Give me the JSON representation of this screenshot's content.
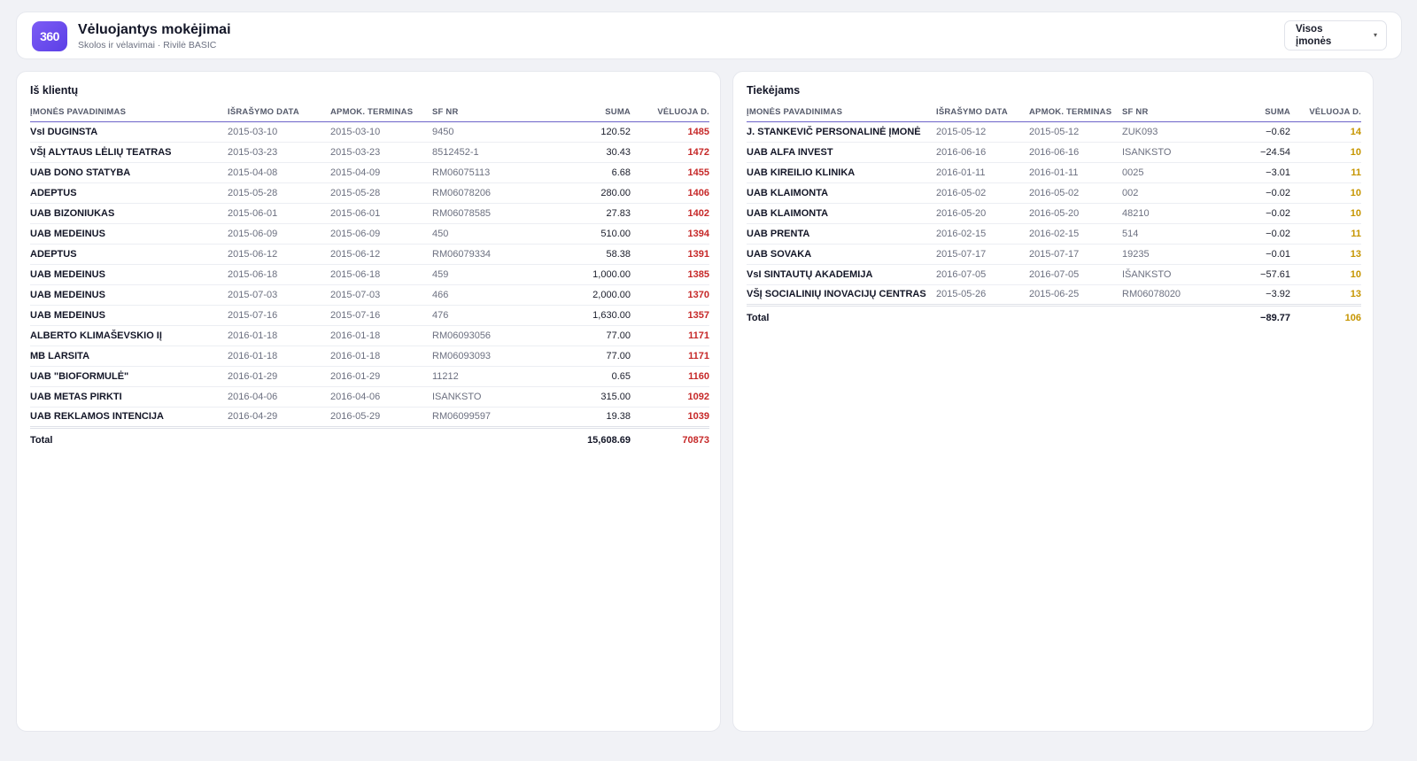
{
  "app": {
    "logo_text": "360",
    "title": "Vėluojantys mokėjimai",
    "subtitle": "Skolos ir vėlavimai · Rivilė BASIC",
    "company_filter": "Visos įmonės",
    "accent_color": "#6d4ef0"
  },
  "clients": {
    "title": "Iš klientų",
    "columns": [
      "ĮMONĖS PAVADINIMAS",
      "IŠRAŠYMO DATA",
      "APMOK. TERMINAS",
      "SF NR",
      "SUMA",
      "VĖLUOJA D."
    ],
    "rows": [
      {
        "name": "VsI DUGINSTA",
        "issued": "2015-03-10",
        "due": "2015-03-10",
        "sf": "9450",
        "sum": "120.52",
        "late": "1485"
      },
      {
        "name": "VŠĮ ALYTAUS LĖLIŲ TEATRAS",
        "issued": "2015-03-23",
        "due": "2015-03-23",
        "sf": "8512452-1",
        "sum": "30.43",
        "late": "1472"
      },
      {
        "name": "UAB DONO STATYBA",
        "issued": "2015-04-08",
        "due": "2015-04-09",
        "sf": "RM06075113",
        "sum": "6.68",
        "late": "1455"
      },
      {
        "name": "ADEPTUS",
        "issued": "2015-05-28",
        "due": "2015-05-28",
        "sf": "RM06078206",
        "sum": "280.00",
        "late": "1406"
      },
      {
        "name": "UAB BIZONIUKAS",
        "issued": "2015-06-01",
        "due": "2015-06-01",
        "sf": "RM06078585",
        "sum": "27.83",
        "late": "1402"
      },
      {
        "name": "UAB MEDEINUS",
        "issued": "2015-06-09",
        "due": "2015-06-09",
        "sf": "450",
        "sum": "510.00",
        "late": "1394"
      },
      {
        "name": "ADEPTUS",
        "issued": "2015-06-12",
        "due": "2015-06-12",
        "sf": "RM06079334",
        "sum": "58.38",
        "late": "1391"
      },
      {
        "name": "UAB MEDEINUS",
        "issued": "2015-06-18",
        "due": "2015-06-18",
        "sf": "459",
        "sum": "1,000.00",
        "late": "1385"
      },
      {
        "name": "UAB MEDEINUS",
        "issued": "2015-07-03",
        "due": "2015-07-03",
        "sf": "466",
        "sum": "2,000.00",
        "late": "1370"
      },
      {
        "name": "UAB MEDEINUS",
        "issued": "2015-07-16",
        "due": "2015-07-16",
        "sf": "476",
        "sum": "1,630.00",
        "late": "1357"
      },
      {
        "name": "ALBERTO KLIMAŠEVSKIO IĮ",
        "issued": "2016-01-18",
        "due": "2016-01-18",
        "sf": "RM06093056",
        "sum": "77.00",
        "late": "1171"
      },
      {
        "name": "MB LARSITA",
        "issued": "2016-01-18",
        "due": "2016-01-18",
        "sf": "RM06093093",
        "sum": "77.00",
        "late": "1171"
      },
      {
        "name": "UAB \"BIOFORMULĖ\"",
        "issued": "2016-01-29",
        "due": "2016-01-29",
        "sf": "11212",
        "sum": "0.65",
        "late": "1160"
      },
      {
        "name": "UAB METAS PIRKTI",
        "issued": "2016-04-06",
        "due": "2016-04-06",
        "sf": "ISANKSTO",
        "sum": "315.00",
        "late": "1092"
      },
      {
        "name": "UAB REKLAMOS INTENCIJA",
        "issued": "2016-04-29",
        "due": "2016-05-29",
        "sf": "RM06099597",
        "sum": "19.38",
        "late": "1039"
      }
    ],
    "total": {
      "label": "Total",
      "sum": "15,608.69",
      "late": "70873"
    }
  },
  "suppliers": {
    "title": "Tiekėjams",
    "columns": [
      "ĮMONĖS PAVADINIMAS",
      "IŠRAŠYMO DATA",
      "APMOK. TERMINAS",
      "SF NR",
      "SUMA",
      "VĖLUOJA D."
    ],
    "rows": [
      {
        "name": "J. STANKEVIČ PERSONALINĖ ĮMONĖ",
        "issued": "2015-05-12",
        "due": "2015-05-12",
        "sf": "ZUK093",
        "sum": "−0.62",
        "late": "14"
      },
      {
        "name": "UAB ALFA INVEST",
        "issued": "2016-06-16",
        "due": "2016-06-16",
        "sf": "ISANKSTO",
        "sum": "−24.54",
        "late": "10"
      },
      {
        "name": "UAB KIREILIO KLINIKA",
        "issued": "2016-01-11",
        "due": "2016-01-11",
        "sf": "0025",
        "sum": "−3.01",
        "late": "11"
      },
      {
        "name": "UAB KLAIMONTA",
        "issued": "2016-05-02",
        "due": "2016-05-02",
        "sf": "002",
        "sum": "−0.02",
        "late": "10"
      },
      {
        "name": "UAB KLAIMONTA",
        "issued": "2016-05-20",
        "due": "2016-05-20",
        "sf": "48210",
        "sum": "−0.02",
        "late": "10"
      },
      {
        "name": "UAB PRENTA",
        "issued": "2016-02-15",
        "due": "2016-02-15",
        "sf": "514",
        "sum": "−0.02",
        "late": "11"
      },
      {
        "name": "UAB SOVAKA",
        "issued": "2015-07-17",
        "due": "2015-07-17",
        "sf": "19235",
        "sum": "−0.01",
        "late": "13"
      },
      {
        "name": "VsI SINTAUTŲ AKADEMIJA",
        "issued": "2016-07-05",
        "due": "2016-07-05",
        "sf": "IŠANKSTO",
        "sum": "−57.61",
        "late": "10"
      },
      {
        "name": "VŠĮ SOCIALINIŲ INOVACIJŲ CENTRAS",
        "issued": "2015-05-26",
        "due": "2015-06-25",
        "sf": "RM06078020",
        "sum": "−3.92",
        "late": "13"
      }
    ],
    "total": {
      "label": "Total",
      "sum": "−89.77",
      "late": "106"
    }
  },
  "colors": {
    "late_clients": "#c62828",
    "late_suppliers": "#c69500",
    "header_underline": "#6d64c9"
  }
}
